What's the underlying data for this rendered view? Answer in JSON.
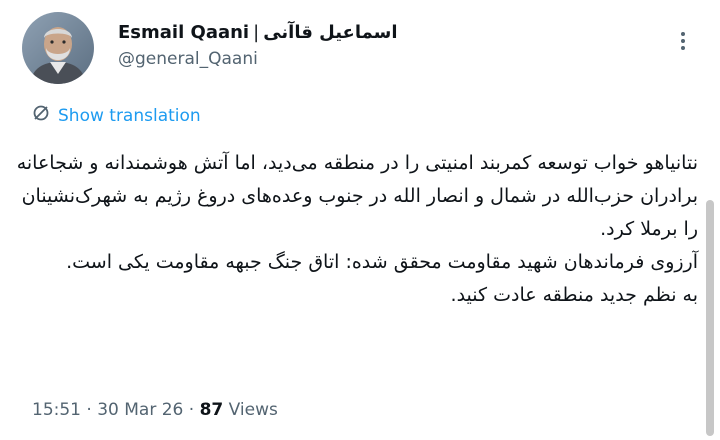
{
  "author": {
    "display_name": "Esmail Qaani",
    "separator": "|",
    "display_name_fa": "اسماعیل قاآنی",
    "handle": "@general_Qaani"
  },
  "translate": {
    "label": "Show translation",
    "icon": "translate-icon"
  },
  "tweet": {
    "paragraphs": [
      "نتانیاهو خواب توسعه کمربند امنیتی را در منطقه می‌دید، اما آتش هوشمندانه و شجاعانه برادران حزب‌الله در شمال و انصار الله در جنوب وعده‌های دروغ رژیم به شهرک‌نشینان را برملا کرد.",
      "آرزوی فرماندهان شهید مقاومت محقق شده: اتاق جنگ جبهه مقاومت یکی است.",
      "به نظم جدید منطقه عادت کنید."
    ]
  },
  "meta": {
    "time": "15:51",
    "dot": "·",
    "date": "30 Mar 26",
    "views_count": "87",
    "views_label": "Views"
  },
  "icons": {
    "more": "more-dots-icon"
  },
  "colors": {
    "accent": "#1d9bf0",
    "secondary": "#536471",
    "text": "#0f1419"
  }
}
